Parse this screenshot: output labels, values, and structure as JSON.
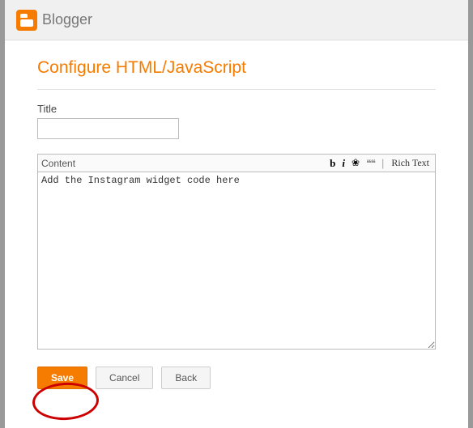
{
  "header": {
    "logo_text": "Blogger"
  },
  "page": {
    "title": "Configure HTML/JavaScript"
  },
  "form": {
    "title_label": "Title",
    "title_value": "",
    "content_label": "Content",
    "content_value": "Add the Instagram widget code here"
  },
  "toolbar": {
    "bold": "b",
    "italic": "i",
    "link_glyph": "❀",
    "quote_glyph": "❝❝",
    "richtext": "Rich Text"
  },
  "buttons": {
    "save": "Save",
    "cancel": "Cancel",
    "back": "Back"
  },
  "colors": {
    "accent": "#f57c00",
    "highlight": "#cc0000"
  }
}
